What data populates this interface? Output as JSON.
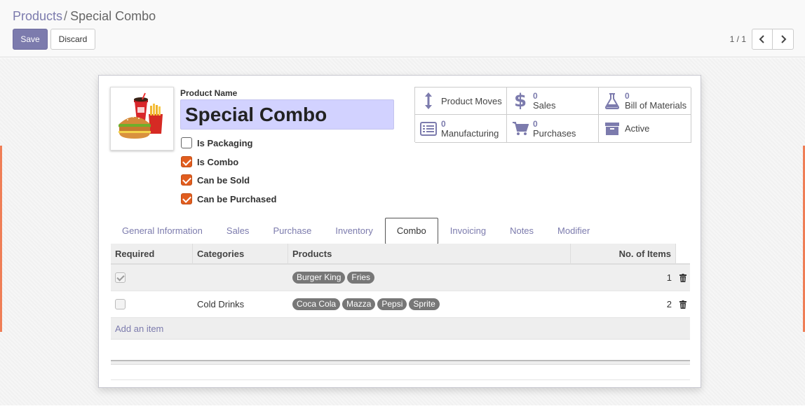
{
  "breadcrumb": {
    "parent": "Products",
    "separator": "/",
    "current": "Special Combo"
  },
  "buttons": {
    "save": "Save",
    "discard": "Discard"
  },
  "pager": {
    "value": "1 / 1"
  },
  "product": {
    "name_label": "Product Name",
    "name": "Special Combo",
    "image_icon": "burger-fries-drink-image"
  },
  "checkboxes": [
    {
      "label": "Is Packaging",
      "checked": false
    },
    {
      "label": "Is Combo",
      "checked": true
    },
    {
      "label": "Can be Sold",
      "checked": true
    },
    {
      "label": "Can be Purchased",
      "checked": true
    }
  ],
  "smart_buttons": [
    {
      "icon": "arrows-vertical-icon",
      "value": "",
      "label": "Product Moves"
    },
    {
      "icon": "dollar-icon",
      "value": "0",
      "label": "Sales"
    },
    {
      "icon": "flask-icon",
      "value": "0",
      "label": "Bill of Materials"
    },
    {
      "icon": "list-icon",
      "value": "0",
      "label": "Manufacturing"
    },
    {
      "icon": "cart-icon",
      "value": "0",
      "label": "Purchases"
    },
    {
      "icon": "archive-icon",
      "value": "",
      "label": "Active"
    }
  ],
  "tabs": [
    "General Information",
    "Sales",
    "Purchase",
    "Inventory",
    "Combo",
    "Invoicing",
    "Notes",
    "Modifier"
  ],
  "active_tab": "Combo",
  "table": {
    "headers": {
      "required": "Required",
      "categories": "Categories",
      "products": "Products",
      "items": "No. of Items"
    },
    "rows": [
      {
        "required": true,
        "category": "",
        "products": [
          "Burger King",
          "Fries"
        ],
        "items": "1"
      },
      {
        "required": false,
        "category": "Cold Drinks",
        "products": [
          "Coca Cola",
          "Mazza",
          "Pepsi",
          "Sprite"
        ],
        "items": "2"
      }
    ],
    "add_item": "Add an item"
  },
  "colors": {
    "brand": "#7c7bad",
    "checkbox_checked": "#e15d1f",
    "name_field_bg": "#d2d2ff",
    "accent": "#ef7e56"
  }
}
